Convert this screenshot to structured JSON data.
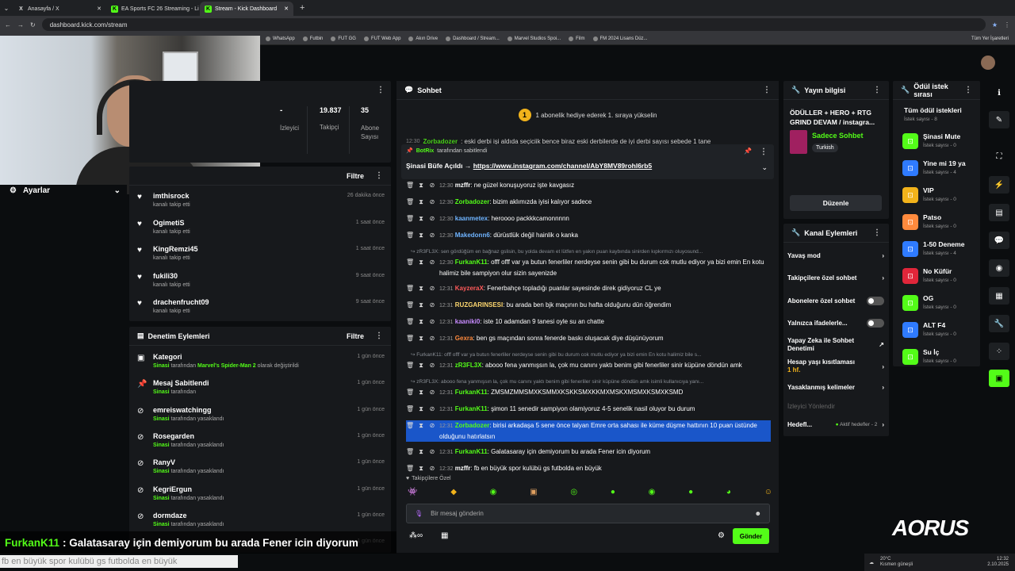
{
  "browser": {
    "tabs": [
      {
        "label": "Anasayfa / X",
        "icon": "x-icon"
      },
      {
        "label": "EA Sports FC 26 Streaming - Li",
        "icon": "kick-icon"
      },
      {
        "label": "Stream - Kick Dashboard",
        "icon": "kick-icon"
      }
    ],
    "url": "dashboard.kick.com/stream",
    "bookmarks": [
      "WhatsApp",
      "Futbin",
      "FUT GG",
      "FUT Web App",
      "Akın Drive",
      "Dashboard / Stream...",
      "Marvel Studios Spoi...",
      "Film",
      "FM 2024 Lisans Düz..."
    ],
    "all_bookmarks": "Tüm Yer İşaretleri"
  },
  "sidebar": {
    "settings": "Ayarlar"
  },
  "stats": [
    {
      "value": "-",
      "label": "İzleyici"
    },
    {
      "value": "19.837",
      "label": "Takipçi"
    },
    {
      "value": "35",
      "label": "Abone Sayısı"
    }
  ],
  "follows": {
    "filter": "Filtre",
    "items": [
      {
        "name": "imthisrock",
        "sub": "kanalı takip etti",
        "time": "26 dakika önce"
      },
      {
        "name": "OgimetiS",
        "sub": "kanalı takip etti",
        "time": "1 saat önce"
      },
      {
        "name": "KingRemzi45",
        "sub": "kanalı takip etti",
        "time": "1 saat önce"
      },
      {
        "name": "fukili30",
        "sub": "kanalı takip etti",
        "time": "9 saat önce"
      },
      {
        "name": "drachenfrucht09",
        "sub": "kanalı takip etti",
        "time": "9 saat önce"
      }
    ]
  },
  "moderation": {
    "title": "Denetim Eylemleri",
    "filter": "Filtre",
    "items": [
      {
        "icon": "category-icon",
        "name": "Kategori",
        "actor": "Sinasi",
        "pre": " tarafından ",
        "game": "Marvel's Spider-Man 2",
        "post": " olarak değiştirildi",
        "time": "1 gün önce"
      },
      {
        "icon": "pin-icon",
        "name": "Mesaj Sabitlendi",
        "actor": "Sinasi",
        "pre": " tarafından",
        "game": "",
        "post": "",
        "time": "1 gün önce"
      },
      {
        "icon": "ban-icon",
        "name": "emreiswatchingg",
        "actor": "Sinasi",
        "pre": " tarafından yasaklandı",
        "game": "",
        "post": "",
        "time": "1 gün önce"
      },
      {
        "icon": "ban-icon",
        "name": "Rosegarden",
        "actor": "Sinasi",
        "pre": " tarafından yasaklandı",
        "game": "",
        "post": "",
        "time": "1 gün önce"
      },
      {
        "icon": "ban-icon",
        "name": "RanyV",
        "actor": "Sinasi",
        "pre": " tarafından yasaklandı",
        "game": "",
        "post": "",
        "time": "1 gün önce"
      },
      {
        "icon": "ban-icon",
        "name": "KegriErgun",
        "actor": "Sinasi",
        "pre": " tarafından yasaklandı",
        "game": "",
        "post": "",
        "time": "1 gün önce"
      },
      {
        "icon": "ban-icon",
        "name": "dormdaze",
        "actor": "Sinasi",
        "pre": " tarafından yasaklandı",
        "game": "",
        "post": "",
        "time": "1 gün önce"
      },
      {
        "icon": "ban-icon",
        "name": "...",
        "actor": "",
        "pre": "",
        "game": "",
        "post": "",
        "time": "1 gün önce"
      }
    ]
  },
  "chat": {
    "title": "Sohbet",
    "banner": "1 abonelik hediye ederek 1. sıraya yükselin",
    "banner_num": "1",
    "top_cut": {
      "time": "12:30",
      "user": "Zorbadozer",
      "text": ": eski derbi işi aldıda seçiciik bence biraz eski derbilerde de iyi derbi sayısı sebede 1 tane"
    },
    "pinned": {
      "by_user": "BotRix",
      "by_text": "tarafından sabitlendi",
      "prefix": "Şinasi Büfe Açıldı → ",
      "link": "https://www.instagram.com/channel/AbY8MV89rohl6rb5"
    },
    "messages": [
      {
        "time": "12:30",
        "user": "mzffr",
        "color": "#ffffff",
        "text": ": ne güzel konuşuyoruz işte kavgasız"
      },
      {
        "time": "12:30",
        "user": "Zorbadozer",
        "color": "#53fc18",
        "text": ": bizim aklımızda iyisi kalıyor sadece"
      },
      {
        "time": "12:30",
        "user": "kaanmetex",
        "color": "#6fb4ff",
        "text": ": heroooo packkkcamonnnnn"
      },
      {
        "time": "12:30",
        "user": "Makedonn6",
        "color": "#6fb4ff",
        "text": ": dürüstlük değil hainlik o kanka"
      },
      {
        "reply": "↪ zR3FL3X: sen gördüğüm en bağnaz gslisin, bu yolda devam et lütfen en yakın puan kaybında sinirden kıpkırmızı oluyosund..."
      },
      {
        "time": "12:30",
        "user": "FurkanK11",
        "color": "#53fc18",
        "text": ": offf offf var ya butun fenerliler nerdeyse senin gibi bu durum cok mutlu ediyor ya bizi emin En kotu halimiz bile sampiyon olur sizin sayenizde"
      },
      {
        "time": "12:31",
        "user": "KayzeraX",
        "color": "#ff5a5a",
        "text": ": Fenerbahçe topladığı puanlar sayesinde direk gidiyoruz CL ye"
      },
      {
        "time": "12:31",
        "user": "RUZGARINSESI",
        "color": "#ffd86f",
        "text": ": bu arada ben bjk maçının bu hafta olduğunu dün öğrendim"
      },
      {
        "time": "12:31",
        "user": "kaaniki0",
        "color": "#c88bff",
        "text": ": iste 10 adamdan 9 tanesi oyle su an chatte"
      },
      {
        "time": "12:31",
        "user": "Gexra",
        "color": "#ff8a3d",
        "text": ": ben gs maçından sonra fenerde baskı oluşacak diye düşünüyorum"
      },
      {
        "reply": "↪ FurkanK11: offf offf var ya butun fenerliler nerdeyse senin gibi bu durum cok mutlu ediyor ya bizi emin En kotu halimiz bile s..."
      },
      {
        "time": "12:31",
        "user": "zR3FL3X",
        "color": "#53fc18",
        "text": ": abooo fena yanmışsın la, çok mu canını yaktı benim gibi fenerliler sinir küpüne döndün amk"
      },
      {
        "reply": "↪ zR3FL3X: abooo fena yanmışsın la, çok mu canını yaktı benim gibi fenerliler sinir küpüne döndün amk isimli kullanıcıya yanı..."
      },
      {
        "time": "12:31",
        "user": "FurkanK11",
        "color": "#53fc18",
        "text": ": ZMSMZMMSMXKSMMXKSKKSMXKKMXMSKXMSMXKSMXKSMD"
      },
      {
        "time": "12:31",
        "user": "FurkanK11",
        "color": "#53fc18",
        "text": ": şimon 11 senedir sampiyon olamiyoruz 4-5 senelik nasil oluyor bu durum"
      },
      {
        "time": "12:31",
        "user": "Zorbadozer",
        "color": "#53fc18",
        "text": ": birisi arkadaşa 5 sene önce talyan Emre orta sahası ile küme düşme hattının 10 puan üstünde olduğunu hatırlatsın",
        "selected": true
      },
      {
        "time": "12:31",
        "user": "FurkanK11",
        "color": "#53fc18",
        "text": ": Galatasaray için demiyorum bu arada Fener icin diyorum"
      },
      {
        "time": "12:32",
        "user": "mzffr",
        "color": "#ffffff",
        "text": ": fb en büyük spor kulübü gs futbolda en büyük"
      }
    ],
    "followers_only": "Takipçilere Özel",
    "placeholder": "Bir mesaj gönderin",
    "send": "Gönder"
  },
  "stream_info": {
    "title": "Yayın bilgisi",
    "stream_title": "ÖDÜLLER + HERO + RTG GRIND DEVAM / instagra...",
    "category": "Sadece Sohbet",
    "language": "Turkish",
    "edit": "Düzenle"
  },
  "channel_actions": {
    "title": "Kanal Eylemleri",
    "slow": "Yavaş mod",
    "followers": "Takipçilere özel sohbet",
    "subs": "Abonelere özel sohbet",
    "emotes": "Yalnızca ifadelerle...",
    "ai": "Yapay Zeka ile Sohbet Denetimi",
    "age": "Hesap yaşı kısıtlaması",
    "age_val": "1 hf.",
    "banned_words": "Yasaklanmış kelimeler",
    "raid": "İzleyici Yönlendir",
    "goals": "Hedefl...",
    "goals_active": "Aktif hedefler - 2"
  },
  "rewards": {
    "title": "Ödül istek sırası",
    "all": "Tüm ödül istekleri",
    "all_count": "İstek sayısı - 8",
    "items": [
      {
        "name": "Şinasi Mute",
        "count": "İstek sayısı - 0",
        "color": "#53fc18"
      },
      {
        "name": "Yine mi 19 ya",
        "count": "İstek sayısı - 4",
        "color": "#2f7bff"
      },
      {
        "name": "VIP",
        "count": "İstek sayısı - 0",
        "color": "#f2b31b"
      },
      {
        "name": "Patso",
        "count": "İstek sayısı - 0",
        "color": "#ff8a3d"
      },
      {
        "name": "1-50 Deneme",
        "count": "İstek sayısı - 4",
        "color": "#2f7bff"
      },
      {
        "name": "No Küfür",
        "count": "İstek sayısı - 0",
        "color": "#e0263a"
      },
      {
        "name": "OG",
        "count": "İstek sayısı - 0",
        "color": "#53fc18"
      },
      {
        "name": "ALT F4",
        "count": "İstek sayısı - 0",
        "color": "#2f7bff"
      },
      {
        "name": "Su İç",
        "count": "İstek sayısı - 0",
        "color": "#53fc18"
      }
    ]
  },
  "overlay": {
    "user": "FurkanK11",
    "text": ": Galatasaray için demiyorum bu arada Fener icin diyorum"
  },
  "ticker": {
    "text": "fb en büyük spor kulübü gs futbolda en büyük"
  },
  "taskbar": {
    "weather": "20°C",
    "weather_sub": "Kısmen güneşli",
    "time": "12:32",
    "date": "2.10.2025"
  },
  "brand": {
    "logo": "AORUS"
  }
}
